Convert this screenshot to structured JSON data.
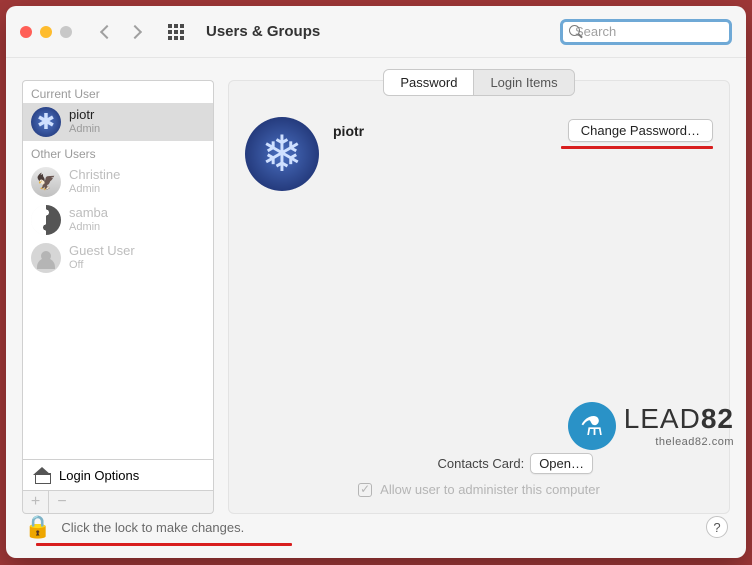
{
  "window": {
    "title": "Users & Groups"
  },
  "search": {
    "placeholder": "Search",
    "value": ""
  },
  "sidebar": {
    "current_header": "Current User",
    "other_header": "Other Users",
    "users": [
      {
        "name": "piotr",
        "role": "Admin",
        "selected": true,
        "avatar": "snow"
      },
      {
        "name": "Christine",
        "role": "Admin",
        "selected": false,
        "avatar": "eagle"
      },
      {
        "name": "samba",
        "role": "Admin",
        "selected": false,
        "avatar": "yinyang"
      },
      {
        "name": "Guest User",
        "role": "Off",
        "selected": false,
        "avatar": "guest"
      }
    ],
    "login_options_label": "Login Options",
    "add_label": "+",
    "remove_label": "−"
  },
  "main": {
    "tabs": [
      {
        "label": "Password",
        "active": true
      },
      {
        "label": "Login Items",
        "active": false
      }
    ],
    "display_name": "piotr",
    "change_password_label": "Change Password…",
    "contacts_label": "Contacts Card:",
    "open_label": "Open…",
    "adminster_label": "Allow user to administer this computer"
  },
  "footer": {
    "lock_text": "Click the lock to make changes.",
    "help_label": "?"
  },
  "watermark": {
    "brand_light": "LEAD",
    "brand_bold": "82",
    "sub": "thelead82.com"
  }
}
